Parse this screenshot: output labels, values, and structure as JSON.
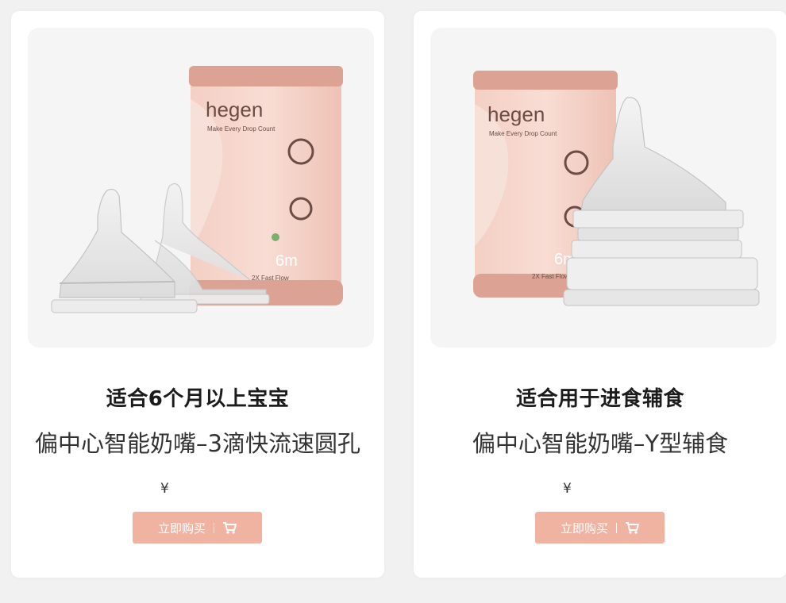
{
  "products": [
    {
      "brand": "hegen",
      "tagline": "Make Every Drop Count",
      "age_mark": "6m",
      "pack_text": "2X Fast Flow",
      "title": "适合6个月以上宝宝",
      "subtitle": "偏中心智能奶嘴–3滴快流速圆孔",
      "price_symbol": "¥",
      "buy_label": "立即购买",
      "cart_icon": "cart-icon"
    },
    {
      "brand": "hegen",
      "tagline": "Make Every Drop Count",
      "age_mark": "6m",
      "pack_text": "2X Fast Flow",
      "title": "适合用于进食辅食",
      "subtitle": "偏中心智能奶嘴–Y型辅食",
      "price_symbol": "¥",
      "buy_label": "立即购买",
      "cart_icon": "cart-icon"
    }
  ],
  "colors": {
    "page_bg": "#f1f1f1",
    "card_bg": "#ffffff",
    "image_bg": "#f5f5f5",
    "button_bg": "#f0b3a2",
    "canister": "#e9b7a8"
  }
}
